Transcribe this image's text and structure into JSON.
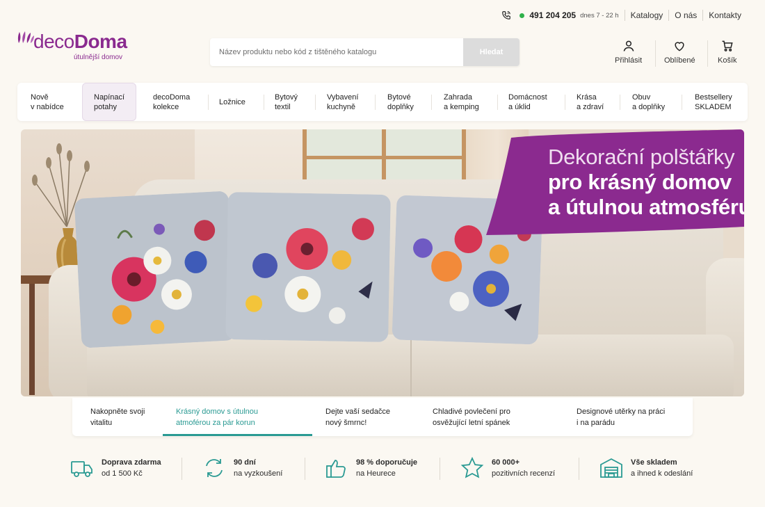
{
  "topbar": {
    "phone_number": "491 204 205",
    "hours": "dnes 7 - 22 h",
    "links": [
      "Katalogy",
      "O nás",
      "Kontakty"
    ]
  },
  "logo": {
    "brand_light": "deco",
    "brand_bold": "Doma",
    "tagline": "útulnější domov"
  },
  "search": {
    "placeholder": "Název produktu nebo kód z tištěného katalogu",
    "button_label": "Hledat"
  },
  "account": {
    "login_label": "Přihlásit",
    "favorites_label": "Oblíbené",
    "cart_label": "Košík"
  },
  "nav": {
    "items": [
      {
        "label": "Nově\nv nabídce"
      },
      {
        "label": "Napínací\npotahy"
      },
      {
        "label": "decoDoma\nkolekce"
      },
      {
        "label": "Ložnice"
      },
      {
        "label": "Bytový\ntextil"
      },
      {
        "label": "Vybavení\nkuchyně"
      },
      {
        "label": "Bytové\ndoplňky"
      },
      {
        "label": "Zahrada\na kemping"
      },
      {
        "label": "Domácnost\na úklid"
      },
      {
        "label": "Krása\na zdraví"
      },
      {
        "label": "Obuv\na doplňky"
      },
      {
        "label": "Bestsellery\nSKLADEM"
      }
    ],
    "active_index": 1
  },
  "hero": {
    "headline_line1": "Dekorační polštářky",
    "headline_line2": "pro krásný domov",
    "headline_line3": "a útulnou atmosféru",
    "ribbon_color": "#8b2a8f"
  },
  "slider_tabs": {
    "items": [
      {
        "label": "Nakopněte svoji\nvitalitu"
      },
      {
        "label": "Krásný domov s útulnou\natmoférou za pár korun"
      },
      {
        "label": "Dejte vaší sedačce\nnový šmrnc!"
      },
      {
        "label": "Chladivé povlečení pro\nosvěžující letní spánek"
      },
      {
        "label": "Designové utěrky na práci\ni na parádu"
      }
    ],
    "active_index": 1,
    "accent_color": "#2a9a93"
  },
  "benefits": [
    {
      "icon": "truck-icon",
      "title": "Doprava zdarma",
      "subtitle": "od 1 500 Kč"
    },
    {
      "icon": "return-arrows-icon",
      "title": "90 dní",
      "subtitle": "na vyzkoušení"
    },
    {
      "icon": "thumbs-up-icon",
      "title": "98 % doporučuje",
      "subtitle": "na Heurece"
    },
    {
      "icon": "star-icon",
      "title": "60 000+",
      "subtitle": "pozitivních recenzí"
    },
    {
      "icon": "warehouse-icon",
      "title": "Vše skladem",
      "subtitle": "a ihned k odeslání"
    }
  ],
  "colors": {
    "brand_purple": "#8a2a8f",
    "teal_accent": "#2a9a93",
    "background": "#fbf8f2"
  }
}
